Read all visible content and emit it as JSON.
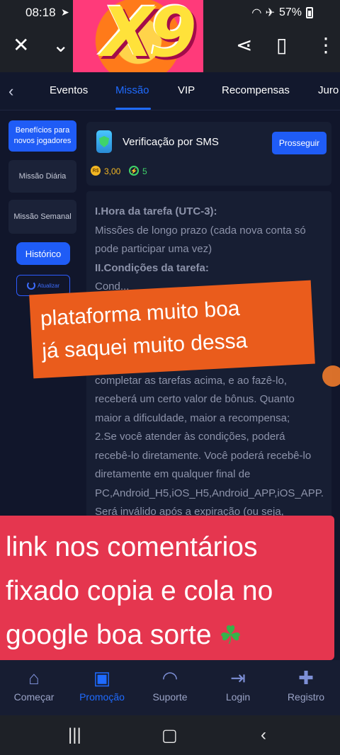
{
  "status": {
    "time": "08:18",
    "battery": "57%"
  },
  "tabs": [
    "Eventos",
    "Missão",
    "VIP",
    "Recompensas",
    "Juro"
  ],
  "sidebar": {
    "new_players": "Benefícios para novos jogadores",
    "daily": "Missão Diária",
    "weekly": "Missão Semanal",
    "history": "Histórico",
    "refresh": "Atualizar"
  },
  "mission": {
    "title": "Verificação por SMS",
    "button": "Prosseguir",
    "coin_label": "R$",
    "amount": "3,00",
    "points": "5"
  },
  "description": {
    "h1": "I.Hora da tarefa (UTC-3):",
    "p1": "Missões de longo prazo (cada nova conta só pode participar uma vez)",
    "h2": "II.Condições da tarefa:",
    "p2a": "Cond...",
    "p2b": "completar as tarefas acima, e ao fazê-lo, receberá um certo valor de bônus. Quanto maior a dificuldade, maior a recompensa;",
    "p3": "2.Se você atender às condições, poderá recebê-lo diretamente. Você poderá recebê-lo diretamente em qualquer final de PC,Android_H5,iOS_H5,Android_APP,iOS_APP. Será inválido após a expiração (ou seja,"
  },
  "overlay1": {
    "line1": "plataforma muito boa",
    "line2": "já saquei muito dessa"
  },
  "overlay2": {
    "line1": "link nos comentários",
    "line2": "fixado copia e cola no",
    "line3": "google boa sorte"
  },
  "bottom_nav": [
    "Começar",
    "Promoção",
    "Suporte",
    "Login",
    "Registro"
  ],
  "colors": {
    "accent": "#1f5cf6",
    "orange_overlay": "#ea5c1c",
    "red_overlay": "#e5364f"
  }
}
